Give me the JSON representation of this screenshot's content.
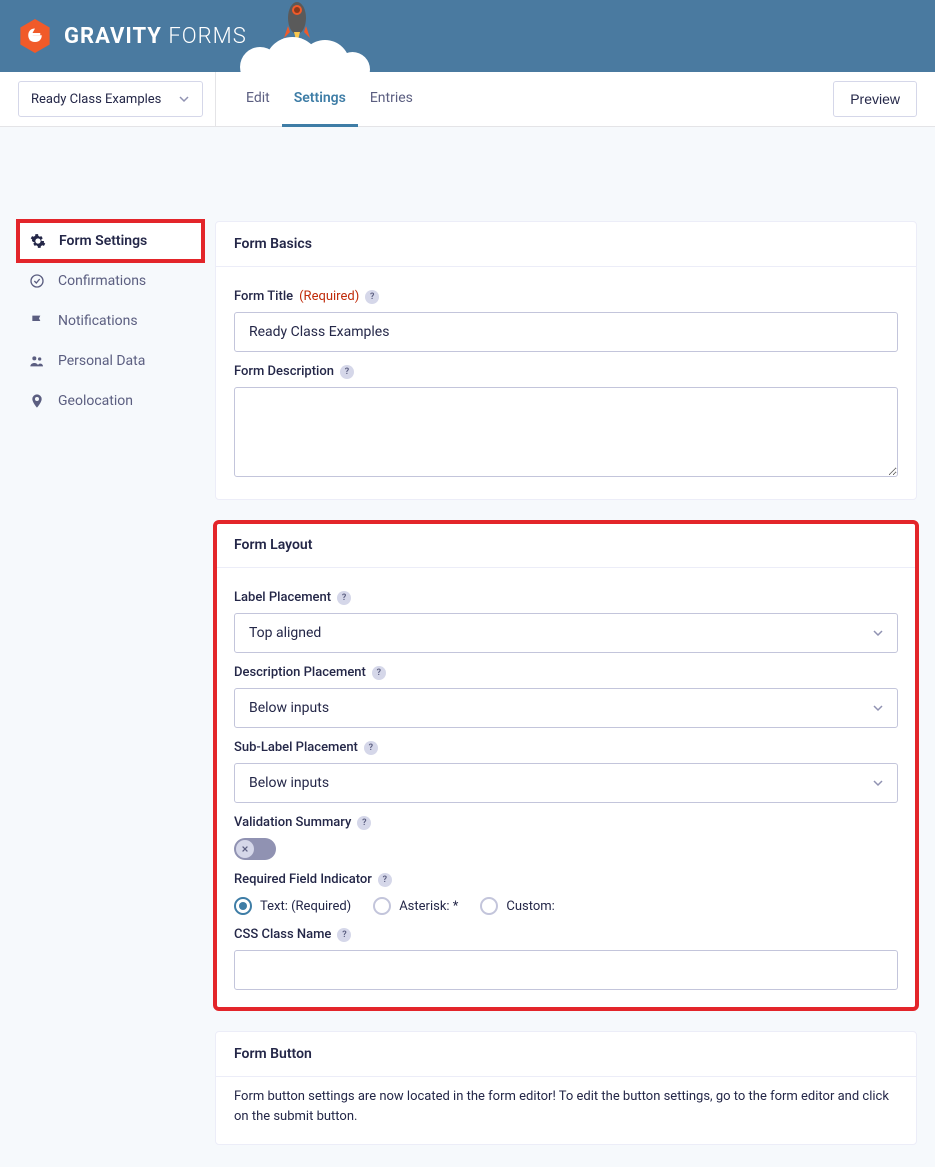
{
  "brand": {
    "strong": "GRAVITY",
    "light": "FORMS"
  },
  "form_selector": {
    "value": "Ready Class Examples"
  },
  "tabs": {
    "edit": "Edit",
    "settings": "Settings",
    "entries": "Entries"
  },
  "preview_label": "Preview",
  "sidebar": {
    "form_settings": "Form Settings",
    "confirmations": "Confirmations",
    "notifications": "Notifications",
    "personal_data": "Personal Data",
    "geolocation": "Geolocation"
  },
  "form_basics": {
    "heading": "Form Basics",
    "title_label": "Form Title",
    "required_tag": "(Required)",
    "title_value": "Ready Class Examples",
    "desc_label": "Form Description",
    "desc_value": ""
  },
  "form_layout": {
    "heading": "Form Layout",
    "label_placement_label": "Label Placement",
    "label_placement_value": "Top aligned",
    "desc_placement_label": "Description Placement",
    "desc_placement_value": "Below inputs",
    "sublabel_placement_label": "Sub-Label Placement",
    "sublabel_placement_value": "Below inputs",
    "validation_label": "Validation Summary",
    "required_indicator_label": "Required Field Indicator",
    "radio_text": "Text: (Required)",
    "radio_asterisk": "Asterisk: *",
    "radio_custom": "Custom:",
    "css_class_label": "CSS Class Name",
    "css_class_value": ""
  },
  "form_button": {
    "heading": "Form Button",
    "info": "Form button settings are now located in the form editor! To edit the button settings, go to the form editor and click on the submit button."
  }
}
